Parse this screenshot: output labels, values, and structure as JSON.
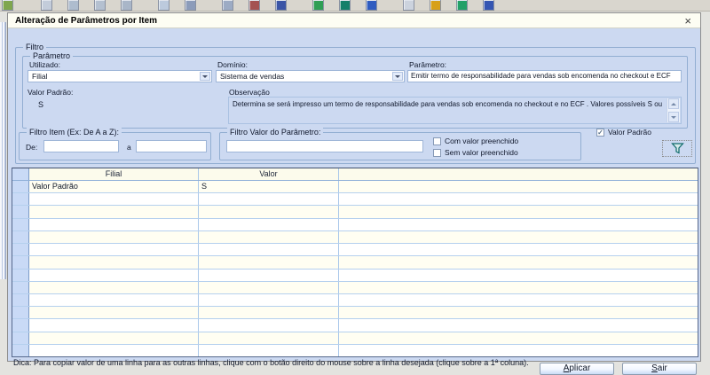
{
  "window": {
    "title": "Alteração de Parâmetros por Item",
    "close_glyph": "×"
  },
  "toolbar": {
    "icons": [
      {
        "name": "app-logo-icon",
        "color": "#7fa64e"
      },
      {
        "name": "new-document-icon",
        "color": "#c3ccda"
      },
      {
        "name": "open-folder-icon",
        "color": "#aebcce"
      },
      {
        "name": "save-icon",
        "color": "#b4c0d0"
      },
      {
        "name": "print-icon",
        "color": "#a9b6c8"
      },
      {
        "name": "search-icon",
        "color": "#bccadd"
      },
      {
        "name": "preview-icon",
        "color": "#8c9cba"
      },
      {
        "name": "grid-icon",
        "color": "#9cabc4"
      },
      {
        "name": "columns-icon",
        "color": "#a45252"
      },
      {
        "name": "link-icon",
        "color": "#3b55a6"
      },
      {
        "name": "refresh-icon",
        "color": "#2f9e54"
      },
      {
        "name": "import-icon",
        "color": "#13806a"
      },
      {
        "name": "export-icon",
        "color": "#2f5cc0"
      },
      {
        "name": "document-icon",
        "color": "#ccd3de"
      },
      {
        "name": "chart-icon",
        "color": "#d7a019"
      },
      {
        "name": "transfer-icon",
        "color": "#22a068"
      },
      {
        "name": "sync-icon",
        "color": "#3556b2"
      }
    ]
  },
  "filter": {
    "group_label": "Filtro",
    "parameter": {
      "group_label": "Parâmetro",
      "utilizado_label": "Utilizado:",
      "utilizado_value": "Filial",
      "dominio_label": "Domínio:",
      "dominio_value": "Sistema de vendas",
      "parametro_label": "Parâmetro:",
      "parametro_value": "Emitir termo de responsabilidade para vendas sob encomenda no checkout e ECF",
      "valor_padrao_label": "Valor Padrão:",
      "valor_padrao_value": "S",
      "observacao_label": "Observação",
      "observacao_value": "Determina se será impresso um termo de responsabilidade para vendas sob encomenda no checkout e no ECF . Valores possíveis S ou N."
    },
    "item_filter": {
      "group_label": "Filtro Item (Ex: De A a Z):",
      "de_label": "De:",
      "de_value": "",
      "a_label": "a",
      "a_value": ""
    },
    "value_filter": {
      "group_label": "Filtro Valor do Parâmetro:",
      "value": "",
      "com_valor_label": "Com valor preenchido",
      "com_valor_mark": "",
      "sem_valor_label": "Sem valor preenchido",
      "sem_valor_mark": ""
    },
    "valor_padrao_checkbox": {
      "label": "Valor Padrão",
      "mark": "✓"
    }
  },
  "table": {
    "columns": [
      "Filial",
      "Valor",
      ""
    ],
    "rows": [
      [
        "Valor Padrão",
        "S",
        ""
      ]
    ],
    "empty_row_count": 13
  },
  "footer": {
    "hint": "Dica: Para copiar valor de uma linha para as outras linhas, clique com o botão direito do mouse sobre a linha desejada (clique sobre a 1ª coluna).",
    "apply_label": "Aplicar",
    "exit_label": "Sair"
  },
  "colors": {
    "dialog_bg": "#ccd9f1",
    "titlebar_bg": "#fdfdf3",
    "table_row_odd": "#fffef2",
    "table_row_even": "#ffffff",
    "grid_line": "#aac8ea",
    "selector_col": "#c9daf6",
    "funnel_accent": "#0f6b6b"
  }
}
